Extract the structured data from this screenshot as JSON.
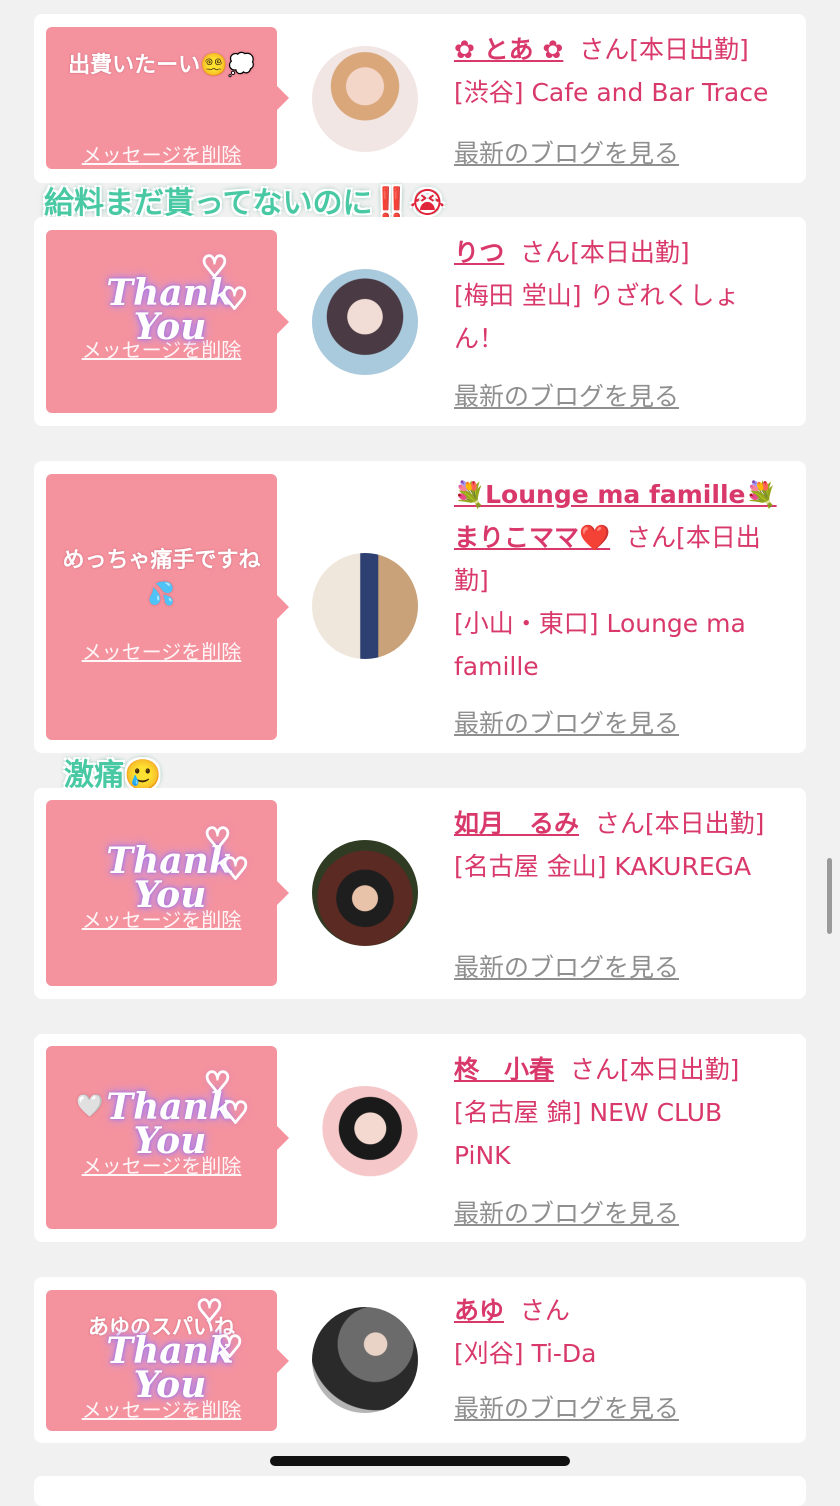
{
  "delete_label": "メッセージを削除",
  "blog_label": "最新のブログを見る",
  "thanks_label": "Thank You",
  "colors": {
    "bubble": "#f4929e",
    "name": "#d9386b",
    "blog_link": "#8f8f8f",
    "sticker": "#49c9a3"
  },
  "cards": [
    {
      "message": "出費いたーい😵‍💫💭",
      "name": "✿ とあ ✿",
      "san": "さん[本日出勤]",
      "shop": "[渋谷] Cafe and Bar Trace"
    },
    {
      "message": "",
      "name": "りつ",
      "san": "さん[本日出勤]",
      "shop": "[梅田 堂山] りざれくしょん！"
    },
    {
      "message": "めっちゃ痛手ですね💦",
      "name": "💐Lounge ma famille💐まりこママ❤️",
      "san": "さん[本日出勤]",
      "shop": "[小山・東口] Lounge ma famille"
    },
    {
      "message": "",
      "name": "如月　るみ",
      "san": "さん[本日出勤]",
      "shop": "[名古屋 金山] KAKUREGA"
    },
    {
      "message": "🤍",
      "name": "柊　小春",
      "san": "さん[本日出勤]",
      "shop": "[名古屋 錦] NEW CLUB PiNK"
    },
    {
      "message": "あゆのスパいね",
      "name": "あゆ",
      "san": "さん",
      "shop": "[刈谷] Ti-Da"
    }
  ],
  "stickers": {
    "salary": "給料まだ貰ってないのに",
    "salary_mark": "‼️😭",
    "pain": "激痛",
    "pain_emoji": "🥲"
  }
}
